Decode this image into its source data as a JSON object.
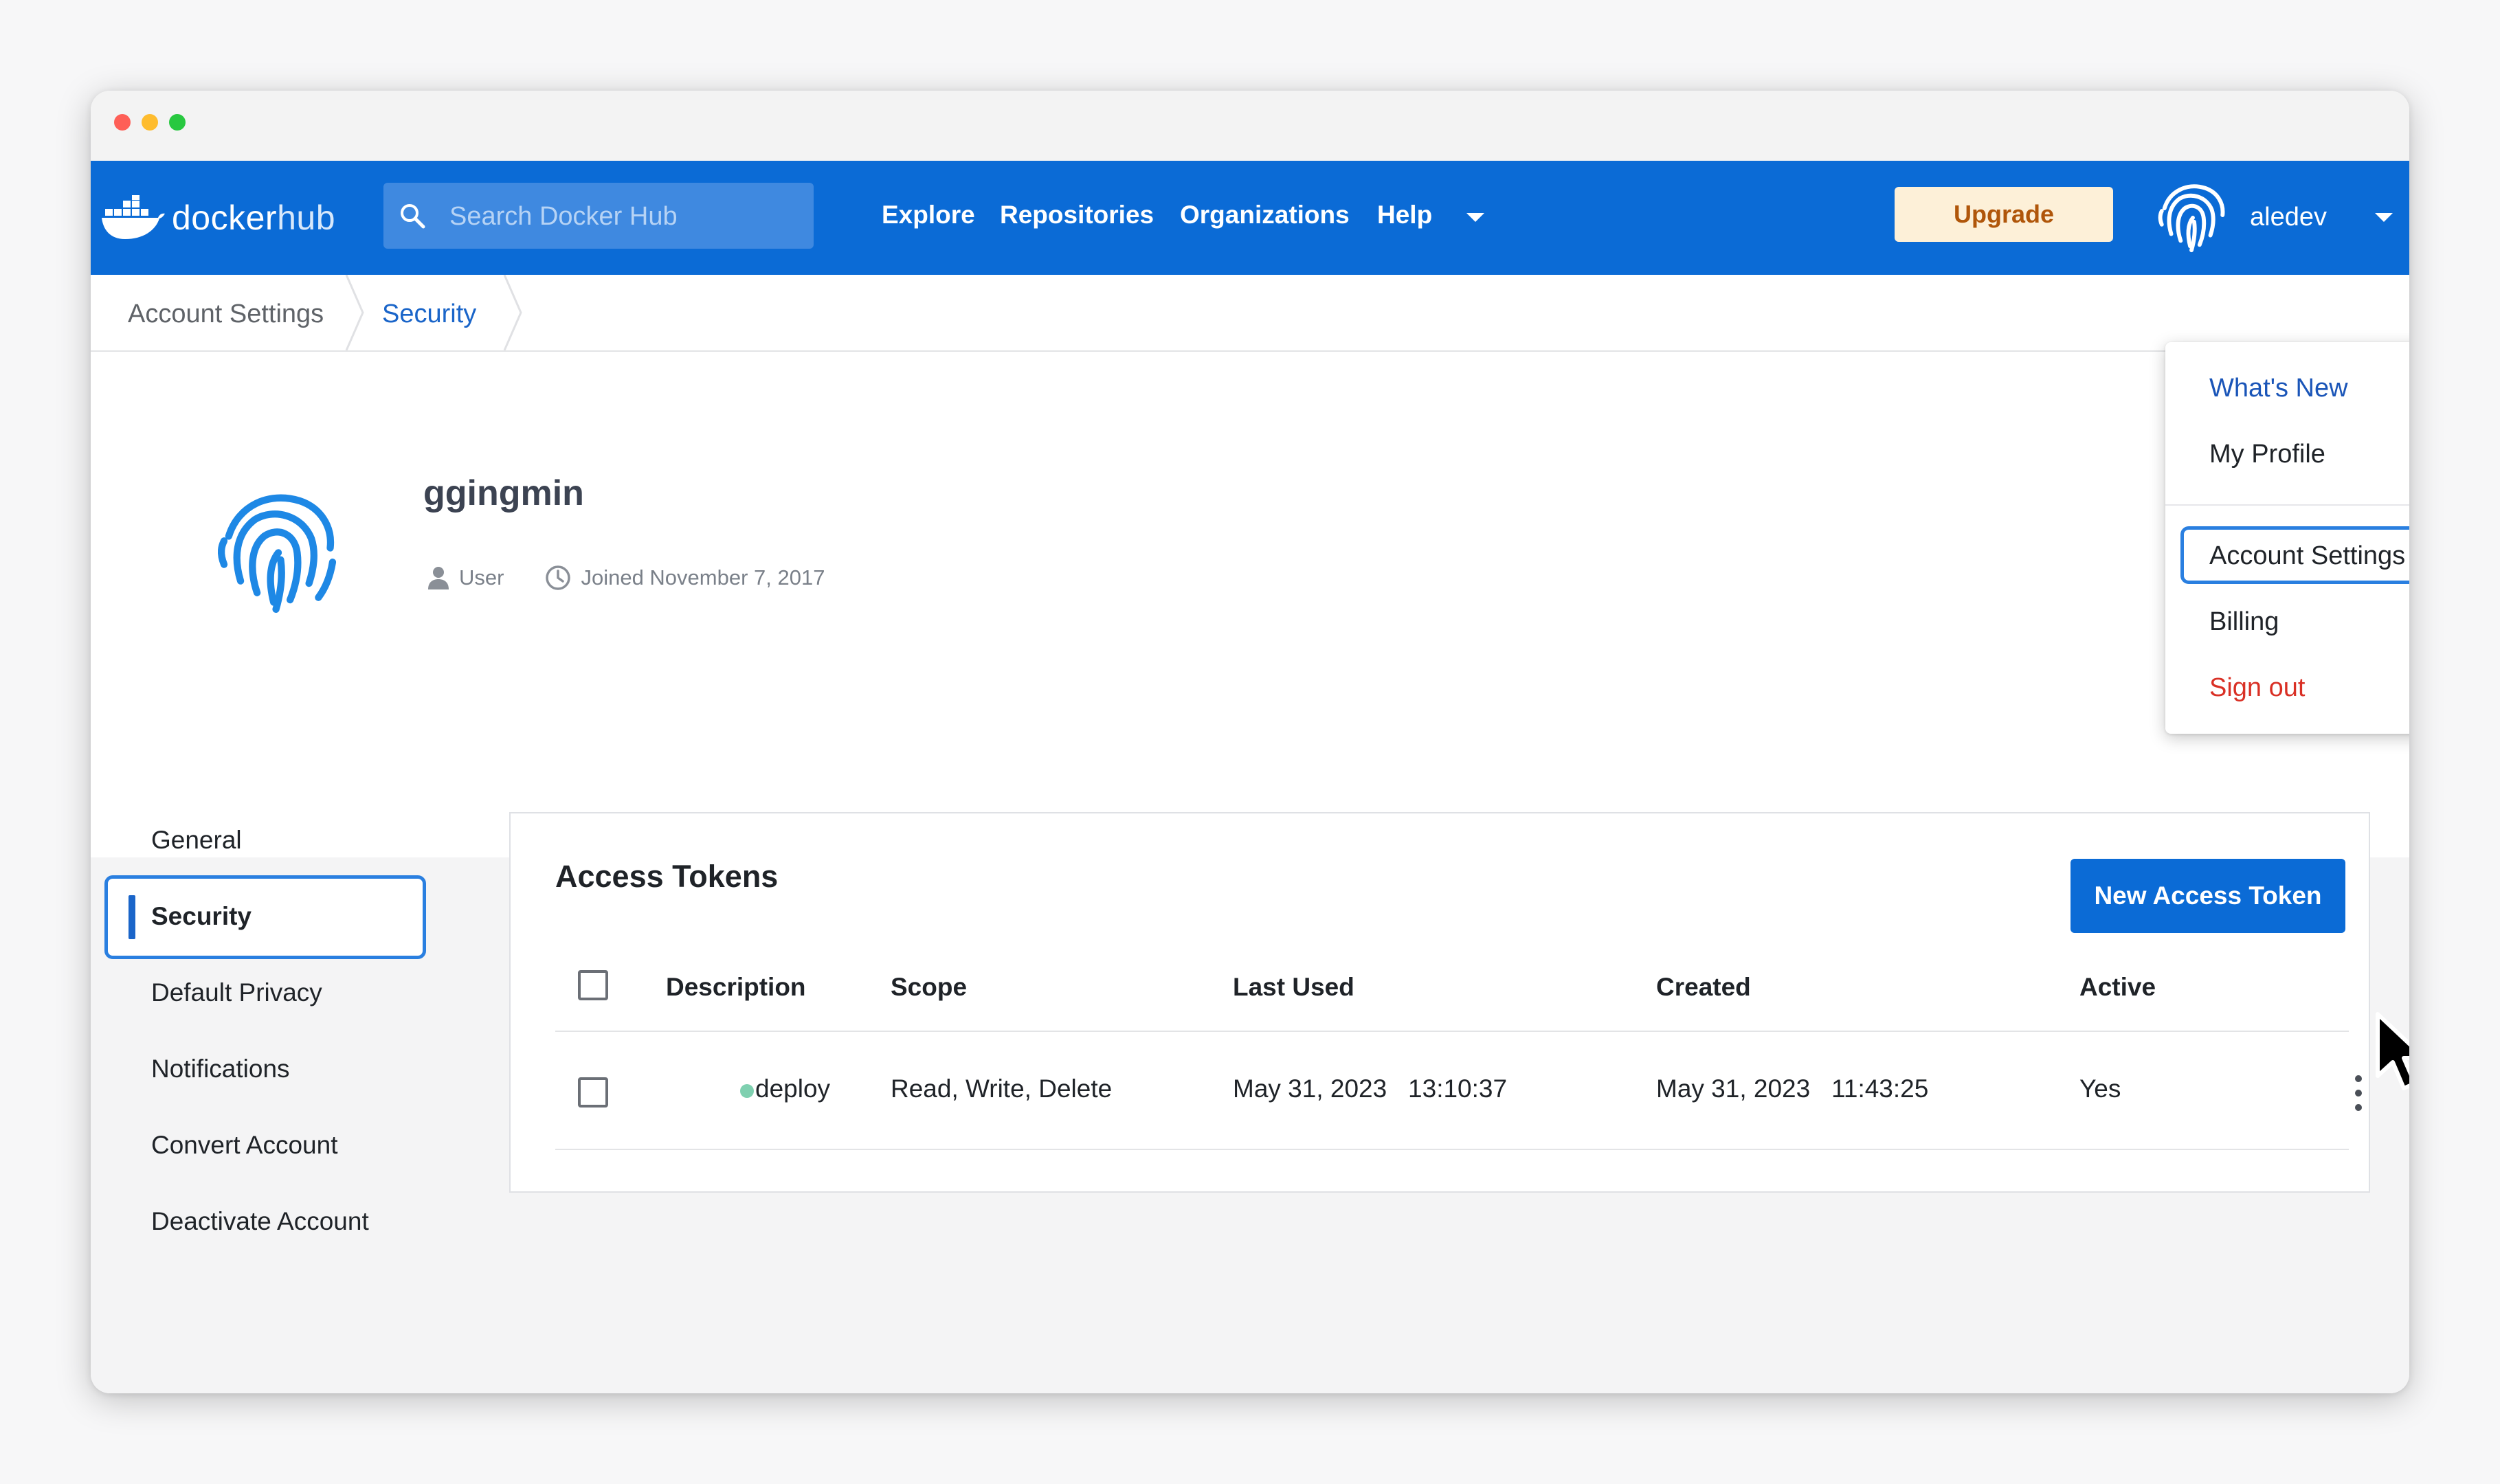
{
  "window": {
    "controls": [
      "close",
      "minimize",
      "zoom"
    ]
  },
  "navbar": {
    "logo": {
      "brand": "docker",
      "product": "hub",
      "icon": "docker-whale-icon"
    },
    "search": {
      "placeholder": "Search Docker Hub",
      "icon": "search-icon"
    },
    "links": [
      "Explore",
      "Repositories",
      "Organizations",
      "Help"
    ],
    "upgrade_label": "Upgrade",
    "username": "aledev",
    "avatar_icon": "fingerprint-icon"
  },
  "breadcrumb": [
    "Account Settings",
    "Security"
  ],
  "profile": {
    "name": "ggingmin",
    "role": "User",
    "joined": "Joined November 7, 2017",
    "avatar_icon": "fingerprint-icon"
  },
  "sidebar": {
    "items": [
      "General",
      "Security",
      "Default Privacy",
      "Notifications",
      "Convert Account",
      "Deactivate Account"
    ],
    "active": "Security"
  },
  "tokens": {
    "title": "Access Tokens",
    "new_button": "New Access Token",
    "columns": [
      "Description",
      "Scope",
      "Last Used",
      "Created",
      "Active"
    ],
    "rows": [
      {
        "description": "deploy",
        "scope": "Read, Write, Delete",
        "last_used": "May 31, 2023   13:10:37",
        "created": "May 31, 2023   11:43:25",
        "active": "Yes"
      }
    ]
  },
  "dropdown": {
    "items": [
      "What's New",
      "My Profile",
      "Account Settings",
      "Billing",
      "Sign out"
    ],
    "focused": "Account Settings"
  },
  "colors": {
    "brand_blue": "#0b6bd6",
    "focus_ring": "#2a7fe0",
    "upgrade_bg": "#fdf0d8",
    "upgrade_text": "#b0560a",
    "sign_out": "#d93025",
    "active_dot": "#7fd0b0"
  }
}
